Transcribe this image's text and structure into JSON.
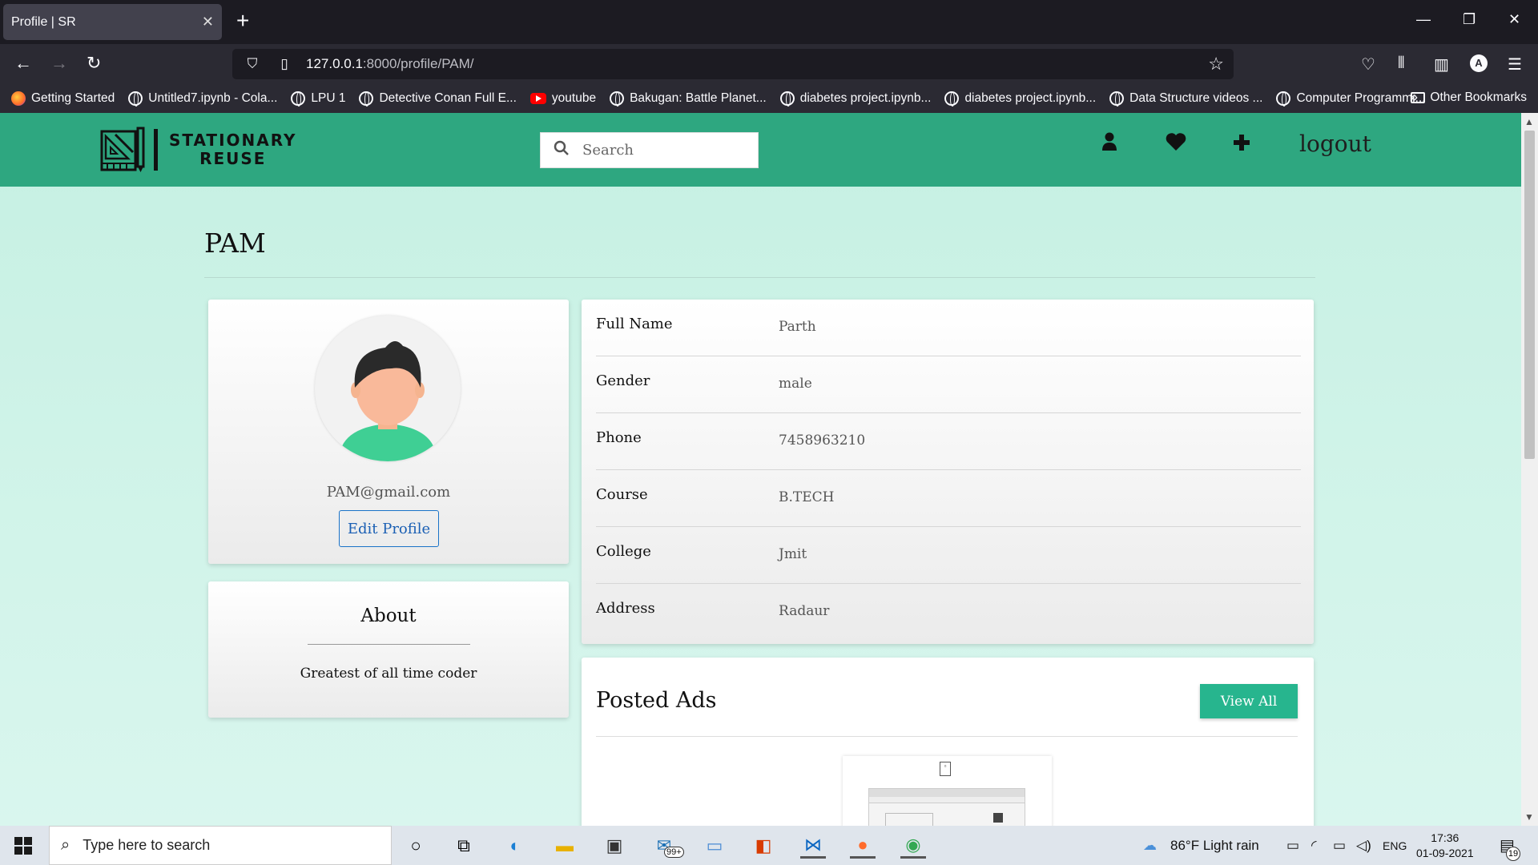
{
  "browser": {
    "tab_title": "Profile | SR",
    "url_host": "127.0.0.1",
    "url_path": ":8000/profile/PAM/",
    "bookmarks": [
      {
        "label": "Getting Started",
        "icon": "firefox-icon"
      },
      {
        "label": "Untitled7.ipynb - Cola...",
        "icon": "globe-icon"
      },
      {
        "label": "LPU 1",
        "icon": "globe-icon"
      },
      {
        "label": "Detective Conan Full E...",
        "icon": "globe-icon"
      },
      {
        "label": "youtube",
        "icon": "youtube-icon"
      },
      {
        "label": "Bakugan: Battle Planet...",
        "icon": "globe-icon"
      },
      {
        "label": "diabetes project.ipynb...",
        "icon": "globe-icon"
      },
      {
        "label": "diabetes project.ipynb...",
        "icon": "globe-icon"
      },
      {
        "label": "Data Structure videos ...",
        "icon": "globe-icon"
      },
      {
        "label": "Computer Programmi...",
        "icon": "globe-icon"
      }
    ],
    "other_bookmarks": "Other Bookmarks"
  },
  "site": {
    "logo_line1": "STATIONARY",
    "logo_line2": "REUSE",
    "search_placeholder": "Search",
    "logout": "logout",
    "accent_color": "#2ea780",
    "button_color": "#27b58e"
  },
  "profile": {
    "username": "PAM",
    "email": "PAM@gmail.com",
    "edit_label": "Edit Profile",
    "about_title": "About",
    "about_text": "Greatest of all time coder",
    "fields": [
      {
        "label": "Full Name",
        "value": "Parth"
      },
      {
        "label": "Gender",
        "value": "male"
      },
      {
        "label": "Phone",
        "value": "7458963210"
      },
      {
        "label": "Course",
        "value": "B.TECH"
      },
      {
        "label": "College",
        "value": "Jmit"
      },
      {
        "label": "Address",
        "value": "Radaur"
      }
    ]
  },
  "ads": {
    "title": "Posted Ads",
    "view_all": "View All"
  },
  "taskbar": {
    "search_placeholder": "Type here to search",
    "mail_badge": "99+",
    "weather": "86°F  Light rain",
    "language": "ENG",
    "time": "17:36",
    "date": "01-09-2021",
    "notifications": "19"
  }
}
